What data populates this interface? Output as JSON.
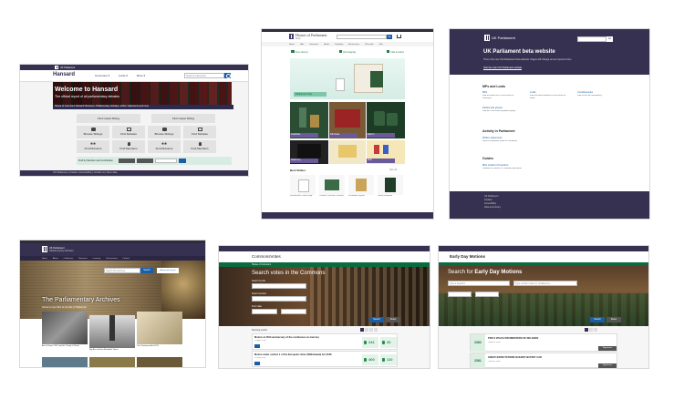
{
  "hansard": {
    "logo": "UK Parliament",
    "brand": "Hansard",
    "nav": [
      "Commons ▾",
      "Lords ▾",
      "More ▾"
    ],
    "search_placeholder": "Search Hansard",
    "hero_title": "Welcome to Hansard",
    "hero_subtitle": "The official report of all parliamentary debates",
    "hero_strip": "House of Commons Hansard: Business, Parliamentary debates, written statements and more",
    "latest_commons": "Find Latest Sitting",
    "latest_lords": "Find Latest Sitting",
    "tiles": [
      {
        "icon": "speaker-icon",
        "label": "Browse Sittings"
      },
      {
        "icon": "book-icon",
        "label": "Find Debates"
      },
      {
        "icon": "speaker-icon",
        "label": "Browse Sittings"
      },
      {
        "icon": "book-icon",
        "label": "Find Debates"
      },
      {
        "icon": "people-icon",
        "label": "Find Divisions"
      },
      {
        "icon": "person-icon",
        "label": "Find Members"
      },
      {
        "icon": "people-icon",
        "label": "Find Divisions"
      },
      {
        "icon": "person-icon",
        "label": "Find Members"
      }
    ],
    "bottom_label": "Find by Member and contribution",
    "footer": "UK Parliament | Cookies | Accessibility | Contact us | Open data"
  },
  "shop": {
    "logo": "Houses of Parliament",
    "logo_sub": "Shop",
    "search_btn": "Go",
    "nav": [
      "Home",
      "Gifts",
      "Souvenirs",
      "Books",
      "Jewellery",
      "Accessories",
      "Gift cards",
      "Sale",
      "Offers"
    ],
    "services": [
      "Free delivery",
      "Gift wrapping",
      "Click & collect"
    ],
    "banner_label": "Parliament Tote",
    "promo_labels": [
      "Celebrate",
      "Gift Ideas",
      "New In",
      "Stationery",
      "Kids"
    ],
    "section_title": "Best Sellers",
    "section_link": "See all",
    "products": [
      "Westminster Palace Mug",
      "Ceramic Portcullis Coasters",
      "Parliament Jigsaw",
      "Green Notebook"
    ]
  },
  "beta": {
    "logo": "UK Parliament",
    "search_btn": "Go",
    "title": "UK Parliament beta website",
    "intro": "This is the new UK Parliament beta website. Pages will change as we improve them.",
    "intro2": "Visit the main UK Parliament website",
    "sections": [
      {
        "heading": "MPs and Lords",
        "links": [
          {
            "title": "MPs",
            "desc": "Find out about MPs in the House of Commons"
          },
          {
            "title": "Lords",
            "desc": "Find out about members of the House of Lords"
          },
          {
            "title": "Constituencies",
            "desc": "Find an MP by constituency"
          },
          {
            "title": "Parties and groups",
            "desc": "Find MPs and Lords by political party"
          }
        ]
      },
      {
        "heading": "Activity in Parliament",
        "links": [
          {
            "title": "Written statements",
            "desc": "Search statements made to Parliament"
          }
        ]
      },
      {
        "heading": "Guides",
        "links": [
          {
            "title": "MPs Guide to Procedure",
            "desc": "Guidance on House of Commons procedure"
          }
        ]
      }
    ],
    "footer_lines": [
      "UK Parliament",
      "Cookies",
      "Accessibility",
      "Data and privacy"
    ]
  },
  "archives": {
    "logo": "UK Parliament",
    "logo_sub": "Parliamentary Archives",
    "nav": [
      "Home",
      "About",
      "Collections",
      "Research",
      "Learning",
      "Get involved",
      "Contact"
    ],
    "search_placeholder": "Search the archives",
    "search_btn": "Search",
    "advanced": "Advanced search",
    "hero_title": "The Parliamentary Archives",
    "hero_subtitle": "Home to over 3km of records of Parliament",
    "cards": [
      "Act of Union 1707 and the Treaty of Union",
      "Big Ben and the Elizabeth Tower",
      "The Parliament Act 1911"
    ]
  },
  "commonsvotes": {
    "brand": "CommonsVotes",
    "crumb": "House of Commons",
    "title": "Search votes in the Commons",
    "filter_label": "Search by title",
    "filter2_label": "Select member",
    "filter3_label": "From date",
    "search_btn": "Search",
    "reset_btn": "Reset",
    "results_label": "Showing results",
    "divisions": [
      {
        "title": "Motion on 50th anniversary of the conference on mercury",
        "date": "20 April 2018",
        "ayes": "241",
        "noes": "33"
      },
      {
        "title": "Motion under section 1 of the European Union (Withdrawal) Act 2018",
        "date": "29 Jan 2019",
        "ayes": "400",
        "noes": "110"
      }
    ]
  },
  "edm": {
    "brand": "Early Day Motions",
    "title_prefix": "Search for",
    "title_highlight": "Early Day Motions",
    "search_placeholder": "Type a keyword",
    "member_placeholder": "Type member name or constituency",
    "search_btn": "Search",
    "reset_btn": "Reset",
    "motions": [
      {
        "number": "2362",
        "title": "TIER 3 VISAS FOR MINISTERS OF RELIGION",
        "meta": "Tabled 4 June",
        "badge": "Signatures"
      },
      {
        "number": "2361",
        "title": "GREAT EXPECTATIONS RAILWAY BUFFET CAR",
        "meta": "Tabled 4 June",
        "badge": "Signatures"
      }
    ]
  }
}
